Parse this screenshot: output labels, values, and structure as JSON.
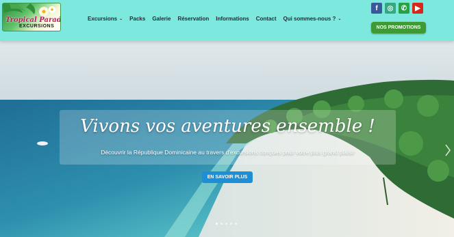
{
  "logo": {
    "title": "Tropical Paradise",
    "subtitle": "EXCURSIONS"
  },
  "nav": {
    "items": [
      {
        "label": "Excursions",
        "has_caret": true
      },
      {
        "label": "Packs",
        "has_caret": false
      },
      {
        "label": "Galerie",
        "has_caret": false
      },
      {
        "label": "Réservation",
        "has_caret": false
      },
      {
        "label": "Informations",
        "has_caret": false
      },
      {
        "label": "Contact",
        "has_caret": false
      },
      {
        "label": "Qui sommes-nous ?",
        "has_caret": true
      }
    ]
  },
  "social": [
    {
      "name": "facebook-icon",
      "glyph": "f",
      "color": "#3b5998"
    },
    {
      "name": "tripadvisor-icon",
      "glyph": "◎",
      "color": "#34a87e"
    },
    {
      "name": "whatsapp-icon",
      "glyph": "✆",
      "color": "#25a244"
    },
    {
      "name": "youtube-icon",
      "glyph": "▶",
      "color": "#d8261c"
    }
  ],
  "promo_label": "NOS PROMOTIONS",
  "hero": {
    "headline": "Vivons vos aventures ensemble !",
    "subline": "Découvrir la République Dominicaine au travers d'excursions conçues pour votre plus grand plaisir",
    "cta_label": "EN SAVOIR PLUS",
    "slide_count": 5,
    "active_slide": 0
  },
  "colors": {
    "header_bg": "#7de8dd",
    "promo_bg": "#3f9a35",
    "cta_bg": "#1e8fd6"
  }
}
